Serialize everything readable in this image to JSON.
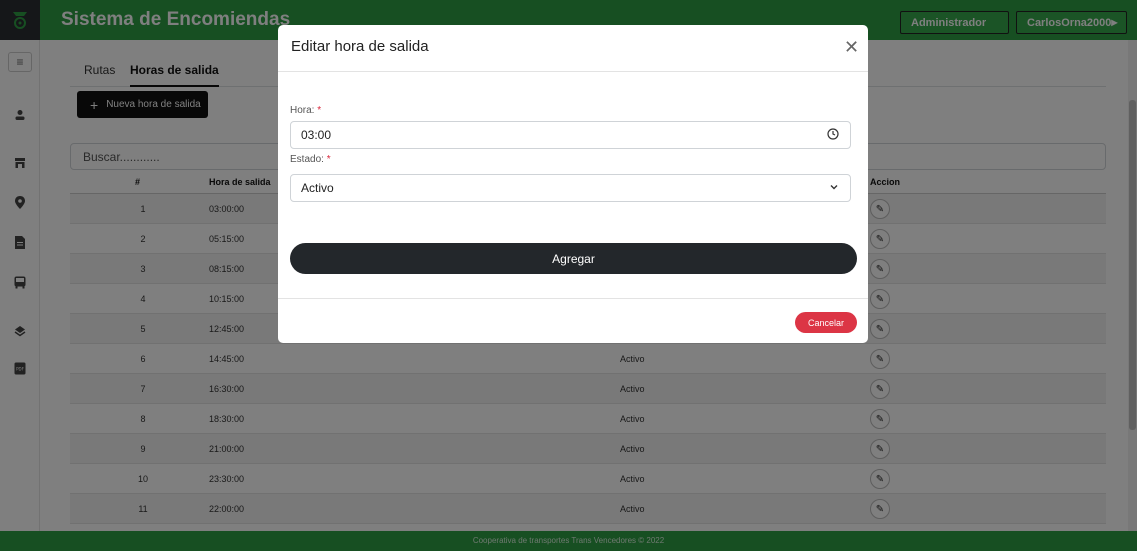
{
  "app": {
    "title": "Sistema de Encomiendas",
    "role_label": "Administrador",
    "user_label": "CarlosOrna2000"
  },
  "tabs": [
    {
      "label": "Rutas"
    },
    {
      "label": "Horas de salida"
    }
  ],
  "new_button": {
    "label": "Nueva hora de salida",
    "icon": "plus-icon"
  },
  "search": {
    "placeholder": "Buscar............"
  },
  "table": {
    "headers": {
      "num": "#",
      "hora": "Hora de salida",
      "accion": "Accion"
    },
    "rows": [
      {
        "num": "1",
        "hora": "03:00:00",
        "estado": ""
      },
      {
        "num": "2",
        "hora": "05:15:00",
        "estado": ""
      },
      {
        "num": "3",
        "hora": "08:15:00",
        "estado": ""
      },
      {
        "num": "4",
        "hora": "10:15:00",
        "estado": ""
      },
      {
        "num": "5",
        "hora": "12:45:00",
        "estado": ""
      },
      {
        "num": "6",
        "hora": "14:45:00",
        "estado": "Activo"
      },
      {
        "num": "7",
        "hora": "16:30:00",
        "estado": "Activo"
      },
      {
        "num": "8",
        "hora": "18:30:00",
        "estado": "Activo"
      },
      {
        "num": "9",
        "hora": "21:00:00",
        "estado": "Activo"
      },
      {
        "num": "10",
        "hora": "23:30:00",
        "estado": "Activo"
      },
      {
        "num": "11",
        "hora": "22:00:00",
        "estado": "Activo"
      }
    ]
  },
  "footer": {
    "text": "Cooperativa de transportes Trans Vencedores © 2022"
  },
  "modal": {
    "title": "Editar hora de salida",
    "hora_label": "Hora:",
    "hora_value": "03:00",
    "estado_label": "Estado:",
    "estado_value": "Activo",
    "required_mark": "*",
    "submit_label": "Agregar",
    "cancel_label": "Cancelar"
  },
  "colors": {
    "header_green": "#2e9e44",
    "danger": "#dc3545",
    "dark": "#23272b"
  }
}
